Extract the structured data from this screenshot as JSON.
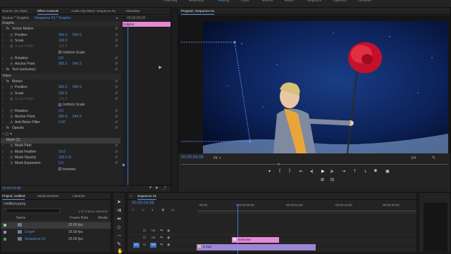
{
  "workspaces": [
    {
      "label": "Learning",
      "active": false
    },
    {
      "label": "Assembly",
      "active": false
    },
    {
      "label": "Editing",
      "active": true
    },
    {
      "label": "Color",
      "active": false
    },
    {
      "label": "Effects",
      "active": false
    },
    {
      "label": "Audio",
      "active": false
    },
    {
      "label": "Graphics",
      "active": false
    },
    {
      "label": "Captions",
      "active": false
    },
    {
      "label": "Libraries",
      "active": false
    }
  ],
  "source_tabs": [
    "Source: (no clips)",
    "Effect Controls",
    "Audio Clip Mixer: Sequence 01",
    "Metadata"
  ],
  "ec": {
    "source_label": "Source * Graphic",
    "sequence_label": "Sequence 01 * Graphic",
    "time": "00;00;05;00",
    "graphic_clip": "Graphic",
    "current_time": "00:00:04:08",
    "sections": [
      {
        "type": "header",
        "label": "Graphic"
      },
      {
        "type": "fx",
        "label": "Vector Motion"
      },
      {
        "type": "prop",
        "label": "Position",
        "v1": "960.0",
        "v2": "540.0"
      },
      {
        "type": "prop",
        "label": "Scale",
        "v1": "100.0"
      },
      {
        "type": "prop_dim",
        "label": "Scale Width",
        "v1": "100.0"
      },
      {
        "type": "check",
        "label": "Uniform Scale"
      },
      {
        "type": "prop",
        "label": "Rotation",
        "v1": "0.0"
      },
      {
        "type": "prop",
        "label": "Anchor Point",
        "v1": "960.0",
        "v2": "540.0"
      },
      {
        "type": "fx",
        "label": "Text (welcome)"
      },
      {
        "type": "header",
        "label": "Video"
      },
      {
        "type": "fx",
        "label": "Motion"
      },
      {
        "type": "prop",
        "label": "Position",
        "v1": "960.0",
        "v2": "540.0"
      },
      {
        "type": "prop",
        "label": "Scale",
        "v1": "100.0"
      },
      {
        "type": "prop_dim",
        "label": "Scale Width",
        "v1": "100.0"
      },
      {
        "type": "check",
        "label": "Uniform Scale"
      },
      {
        "type": "prop",
        "label": "Rotation",
        "v1": "0.0"
      },
      {
        "type": "prop",
        "label": "Anchor Point",
        "v1": "960.0",
        "v2": "540.0"
      },
      {
        "type": "prop",
        "label": "Anti-flicker Filter",
        "v1": "0.00"
      },
      {
        "type": "fx",
        "label": "Opacity"
      },
      {
        "type": "icons"
      },
      {
        "type": "mask",
        "label": "Mask (1)"
      },
      {
        "type": "prop",
        "label": "Mask Path"
      },
      {
        "type": "prop",
        "label": "Mask Feather",
        "v1": "10.0"
      },
      {
        "type": "prop",
        "label": "Mask Opacity",
        "v1": "100.0 %"
      },
      {
        "type": "prop",
        "label": "Mask Expansion",
        "v1": "0.0"
      },
      {
        "type": "check",
        "label": "Inverted"
      }
    ]
  },
  "program": {
    "title": "Program: Sequence 01",
    "timecode": "00:00:04:08",
    "fit": "Fit",
    "fraction": "1/4"
  },
  "project": {
    "tabs": [
      "Project: Untitled",
      "Media Browser",
      "Libraries"
    ],
    "file": "Untitled.prproj",
    "selection": "1 of 3 items selected",
    "columns": [
      "Name",
      "Frame Rate",
      "Media"
    ],
    "items": [
      {
        "name": "",
        "rate": "25.00 fps",
        "color": "#8fd17a"
      },
      {
        "name": "5.mp4",
        "rate": "25.00 fps",
        "color": "#9b86d6"
      },
      {
        "name": "Sequence 01",
        "rate": "25.00 fps",
        "color": "#3fa843"
      }
    ]
  },
  "timeline": {
    "seq_tab": "Sequence 01",
    "timecode": "00:00:04:08",
    "ruler": [
      "00:00",
      "00:00:05:00",
      "00:00:10:00",
      "00:00:15:00",
      "00:00:20:00"
    ],
    "clip_graphic": "welcome",
    "clip_video": "5.mp4",
    "tracks": [
      "V3",
      "V2",
      "V1"
    ]
  }
}
